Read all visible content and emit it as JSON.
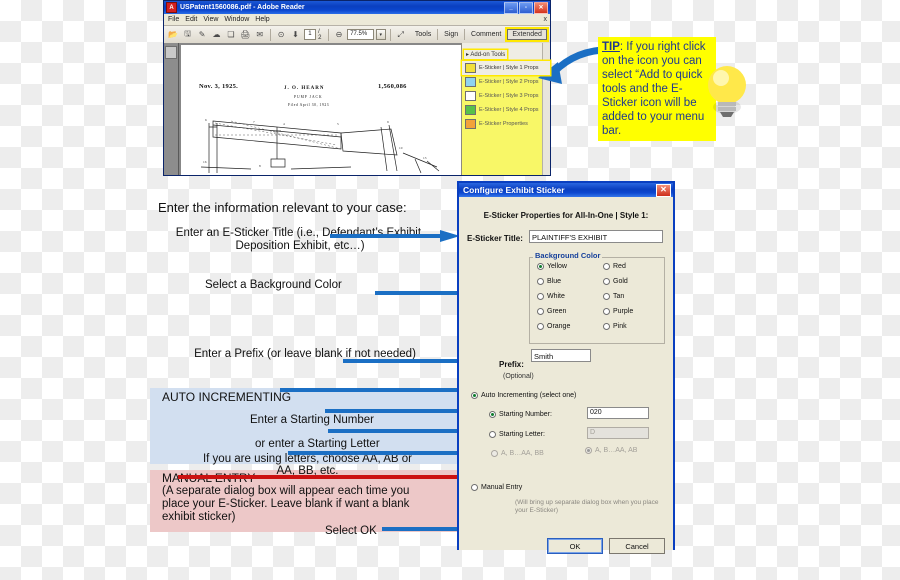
{
  "reader": {
    "title": "USPatent1560086.pdf - Adobe Reader",
    "app_icon": "adobe-icon",
    "window_buttons": [
      "minimize",
      "maximize",
      "close"
    ],
    "menus": [
      "File",
      "Edit",
      "View",
      "Window",
      "Help"
    ],
    "menu_close": "x",
    "toolbar": {
      "page_current": "1",
      "page_total": "/ 2",
      "zoom": "77.5%",
      "icons": [
        "open-file-icon",
        "save-icon",
        "sign-icon",
        "cloud-icon",
        "copy-icon",
        "print-icon",
        "email-icon",
        "rotate-icon",
        "download-icon",
        "zoom-out-icon",
        "select-tool-icon"
      ],
      "right_links": [
        "Tools",
        "Sign",
        "Comment"
      ],
      "extended_label": "Extended"
    },
    "sidebar": {
      "header": "Add-on Tools",
      "items": [
        {
          "label": "E-Sticker | Style 1 Props",
          "swatch": "#f2e03a",
          "highlight": true
        },
        {
          "label": "E-Sticker | Style 2 Props",
          "swatch": "#8fd3f0",
          "highlight": false
        },
        {
          "label": "E-Sticker | Style 3 Props",
          "swatch": "#ffffff",
          "highlight": false
        },
        {
          "label": "E-Sticker | Style 4 Props",
          "swatch": "#58c04a",
          "highlight": false
        },
        {
          "label": "E-Sticker Properties",
          "swatch": "#f2a23a",
          "highlight": false
        }
      ]
    },
    "document": {
      "date": "Nov. 3, 1925.",
      "inventor": "J. O. HEARN",
      "subject": "PUMP JACK",
      "filed": "Filed April 30, 1923",
      "patent_number": "1,560,086"
    }
  },
  "tip": {
    "label": "TIP",
    "text": ": If you right click on the icon you can select “Add to quick tools and the E-Sticker icon will be added to your menu bar.",
    "bulb_icon": "lightbulb-icon",
    "background": "#ffff00",
    "text_color": "#1f3a8f"
  },
  "instructions": {
    "heading": "Enter the information relevant to your case:",
    "title_hint": "Enter an E-Sticker Title (i.e., Defendant’s Exhibit, Deposition Exhibit, etc…)",
    "color_hint": "Select a Background Color",
    "prefix_hint": "Enter a Prefix (or leave blank if not needed)",
    "auto_header": "AUTO INCREMENTING",
    "auto_band_color": "#d2dff0",
    "start_number_hint": "Enter a Starting Number",
    "start_letter_hint": "or enter a Starting Letter",
    "letters_hint": "If you are using letters, choose AA, AB or AA, BB, etc.",
    "manual_header": "MANUAL ENTRY",
    "manual_band_color": "#edc8c8",
    "manual_body": "(A separate dialog box will appear each time you place your E-Sticker. Leave blank if want a blank exhibit sticker)",
    "ok_hint": "Select OK",
    "arrow_color": "#1b6fc4",
    "manual_arrow_color": "#cc1111"
  },
  "dialog": {
    "title": "Configure Exhibit Sticker",
    "close_label": "✕",
    "heading": "E-Sticker Properties for All-In-One | Style 1:",
    "title_label": "E-Sticker Title:",
    "title_value": "PLAINTIFF'S EXHIBIT",
    "background_group": {
      "legend": "Background Color",
      "legend_color": "#16409b",
      "left_column": [
        "Yellow",
        "Blue",
        "White",
        "Green",
        "Orange"
      ],
      "right_column": [
        "Red",
        "Gold",
        "Tan",
        "Purple",
        "Pink"
      ],
      "selected": "Yellow"
    },
    "prefix_label": "Prefix:",
    "prefix_value": "Smith",
    "optional_label": "(Optional)",
    "auto_label": "Auto Incrementing (select one)",
    "auto_selected": true,
    "starting_number_label": "Starting Number:",
    "starting_number_value": "020",
    "starting_number_selected": true,
    "starting_letter_label": "Starting Letter:",
    "starting_letter_value": "D",
    "starting_letter_selected": false,
    "letter_option_1": "A, B…AA, BB",
    "letter_option_2": "A, B…AA, AB",
    "letter_option_2_selected": true,
    "manual_label": "Manual Entry",
    "manual_selected": false,
    "manual_note": "(Will bring up separate dialog box when you place your E-Sticker)",
    "ok_label": "OK",
    "cancel_label": "Cancel",
    "titlebar_color": "#0a3fc0",
    "border_color": "#0a3fc0"
  }
}
